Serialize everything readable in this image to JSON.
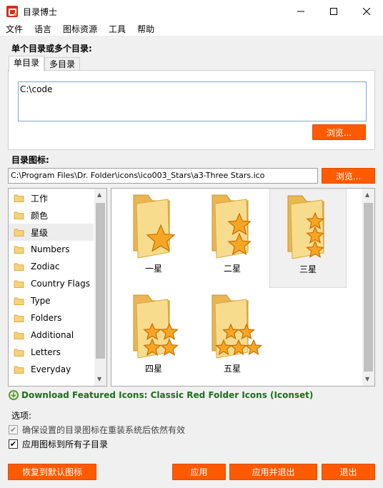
{
  "window": {
    "title": "目录博士",
    "app_icon": "folder-app-icon",
    "controls": [
      "minimize-icon",
      "maximize-icon",
      "close-icon"
    ]
  },
  "menu": [
    "文件",
    "语言",
    "图标资源",
    "工具",
    "帮助"
  ],
  "directory_section": {
    "label": "单个目录或多个目录:",
    "tabs": [
      {
        "label": "单目录",
        "active": true
      },
      {
        "label": "多目录",
        "active": false
      }
    ],
    "directory_value": "C:\\code",
    "browse_label": "浏览..."
  },
  "icon_section": {
    "label": "目录图标:",
    "path_value": "C:\\Program Files\\Dr. Folder\\icons\\ico003_Stars\\a3-Three Stars.ico",
    "browse_label": "浏览..."
  },
  "categories": [
    {
      "label": "工作",
      "selected": false
    },
    {
      "label": "颜色",
      "selected": false
    },
    {
      "label": "星级",
      "selected": true
    },
    {
      "label": "Numbers",
      "selected": false
    },
    {
      "label": "Zodiac",
      "selected": false
    },
    {
      "label": "Country Flags",
      "selected": false
    },
    {
      "label": "Type",
      "selected": false
    },
    {
      "label": "Folders",
      "selected": false
    },
    {
      "label": "Additional",
      "selected": false
    },
    {
      "label": "Letters",
      "selected": false
    },
    {
      "label": "Everyday",
      "selected": false
    }
  ],
  "icons": [
    {
      "label": "一星",
      "stars": 1,
      "selected": false
    },
    {
      "label": "二星",
      "stars": 2,
      "selected": false
    },
    {
      "label": "三星",
      "stars": 3,
      "selected": true
    },
    {
      "label": "四星",
      "stars": 4,
      "selected": false
    },
    {
      "label": "五星",
      "stars": 5,
      "selected": false
    }
  ],
  "download_link": "Download Featured Icons: Classic Red Folder Icons (Iconset)",
  "options": {
    "label": "选项:",
    "items": [
      {
        "label": "确保设置的目录图标在重装系统后依然有效",
        "checked": true,
        "enabled": false
      },
      {
        "label": "应用图标到所有子目录",
        "checked": true,
        "enabled": true
      }
    ]
  },
  "buttons": {
    "restore_default": "恢复到默认图标",
    "apply": "应用",
    "apply_exit": "应用并退出",
    "exit": "退出"
  },
  "colors": {
    "accent_orange": "#ff5a00",
    "link_green": "#1e6e1e",
    "star_gold": "#f6a623",
    "folder_yellow": "#f6d27a"
  }
}
